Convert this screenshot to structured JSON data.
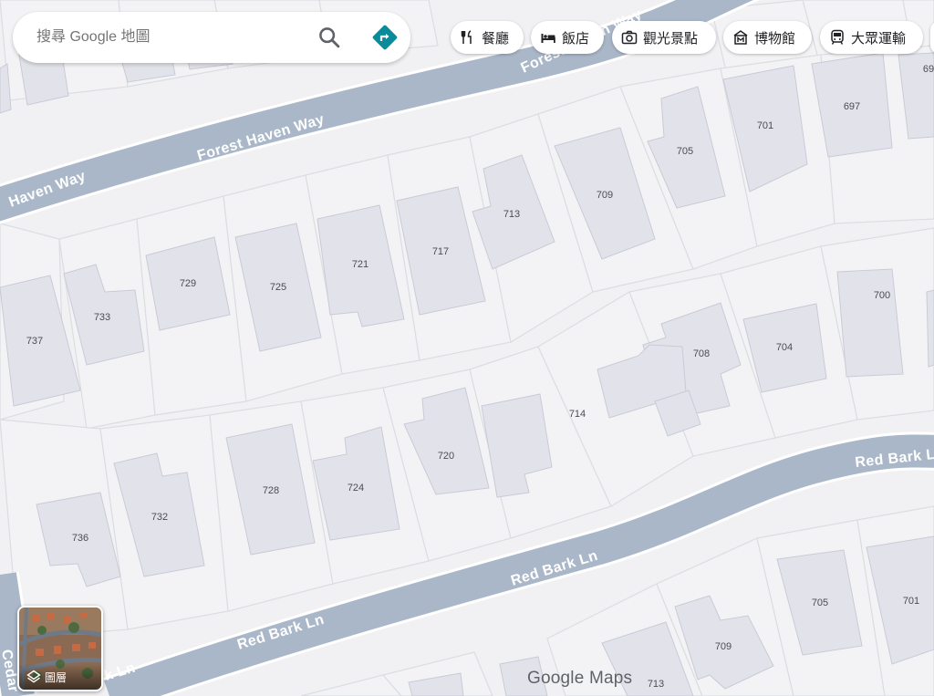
{
  "search": {
    "placeholder": "搜尋 Google 地圖"
  },
  "chips": [
    {
      "label": "餐廳",
      "icon": "restaurant-icon"
    },
    {
      "label": "飯店",
      "icon": "hotel-icon"
    },
    {
      "label": "觀光景點",
      "icon": "camera-icon"
    },
    {
      "label": "博物館",
      "icon": "museum-icon"
    },
    {
      "label": "大眾運輸",
      "icon": "transit-icon"
    }
  ],
  "roads": {
    "forest_top": "Forest Haven Way",
    "forest_main": "Forest Haven Way",
    "forest_left": "Haven Way",
    "redbark_right": "Red Bark Ln",
    "redbark_mid": "Red Bark Ln",
    "redbark_low": "Red Bark Ln",
    "redbark_left": "rk Ln",
    "cedar": "Cedar"
  },
  "addresses": {
    "a697": "697",
    "a69": "69",
    "a701": "701",
    "a705": "705",
    "a709": "709",
    "a713": "713",
    "a717": "717",
    "a721": "721",
    "a725": "725",
    "a729": "729",
    "a733": "733",
    "a737": "737",
    "a700": "700",
    "a704": "704",
    "a708": "708",
    "a714": "714",
    "a720": "720",
    "a724": "724",
    "a728": "728",
    "a732": "732",
    "a736": "736",
    "b705": "705",
    "b701": "701",
    "b709": "709",
    "b713": "713"
  },
  "layers": {
    "label": "圖層"
  },
  "brand": {
    "logo": "Google Maps"
  }
}
